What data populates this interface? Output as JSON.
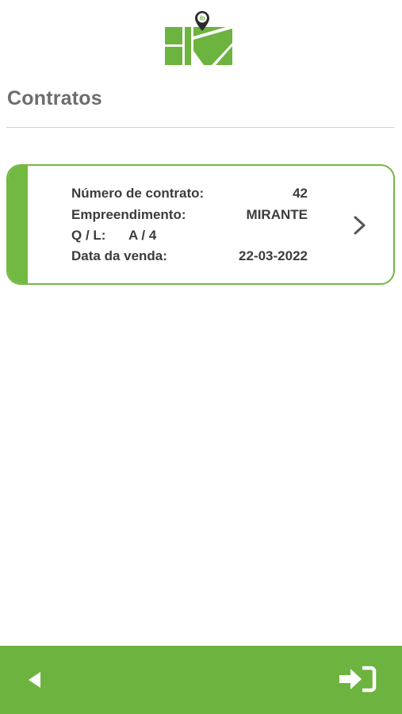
{
  "header": {
    "logo_badge": "ib",
    "title": "Contratos"
  },
  "contract": {
    "numero_label": "Número de contrato:",
    "numero_value": "42",
    "empreendimento_label": "Empreendimento:",
    "empreendimento_value": "MIRANTE",
    "ql_label": "Q / L:",
    "ql_value": "A / 4",
    "data_label": "Data da venda:",
    "data_value": "22-03-2022"
  },
  "icons": {
    "logo": "map-pin-logo-icon",
    "open": "chevron-right-icon",
    "back": "back-arrow-icon",
    "logout": "logout-icon"
  },
  "colors": {
    "accent": "#6db33f",
    "card_border": "#72b942",
    "title": "#6d6d6d",
    "text": "#3c3c3c"
  }
}
